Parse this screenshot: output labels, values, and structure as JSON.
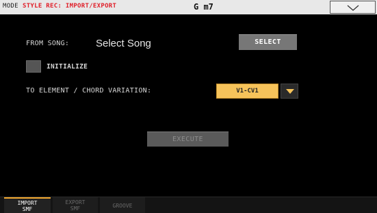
{
  "header": {
    "mode_label": "MODE",
    "mode_value": "STYLE REC: IMPORT/EXPORT",
    "chord": "G m7"
  },
  "main": {
    "from_song_label": "FROM SONG:",
    "song_value": "Select Song",
    "select_button": "SELECT",
    "initialize_label": "INITIALIZE",
    "initialize_checked": false,
    "element_label": "TO ELEMENT / CHORD VARIATION:",
    "element_value": "V1-CV1",
    "execute_button": "EXECUTE"
  },
  "tabs": [
    {
      "line1": "IMPORT",
      "line2": "SMF",
      "active": true
    },
    {
      "line1": "EXPORT",
      "line2": "SMF",
      "active": false
    },
    {
      "line1": "GROOVE",
      "line2": "",
      "active": false
    }
  ],
  "colors": {
    "accent": "#f6c35a",
    "mode_red": "#e0202a",
    "tab_highlight": "#f2a82e"
  },
  "icons": {
    "menu": "chevron-down-icon",
    "dropdown": "triangle-down-icon"
  }
}
